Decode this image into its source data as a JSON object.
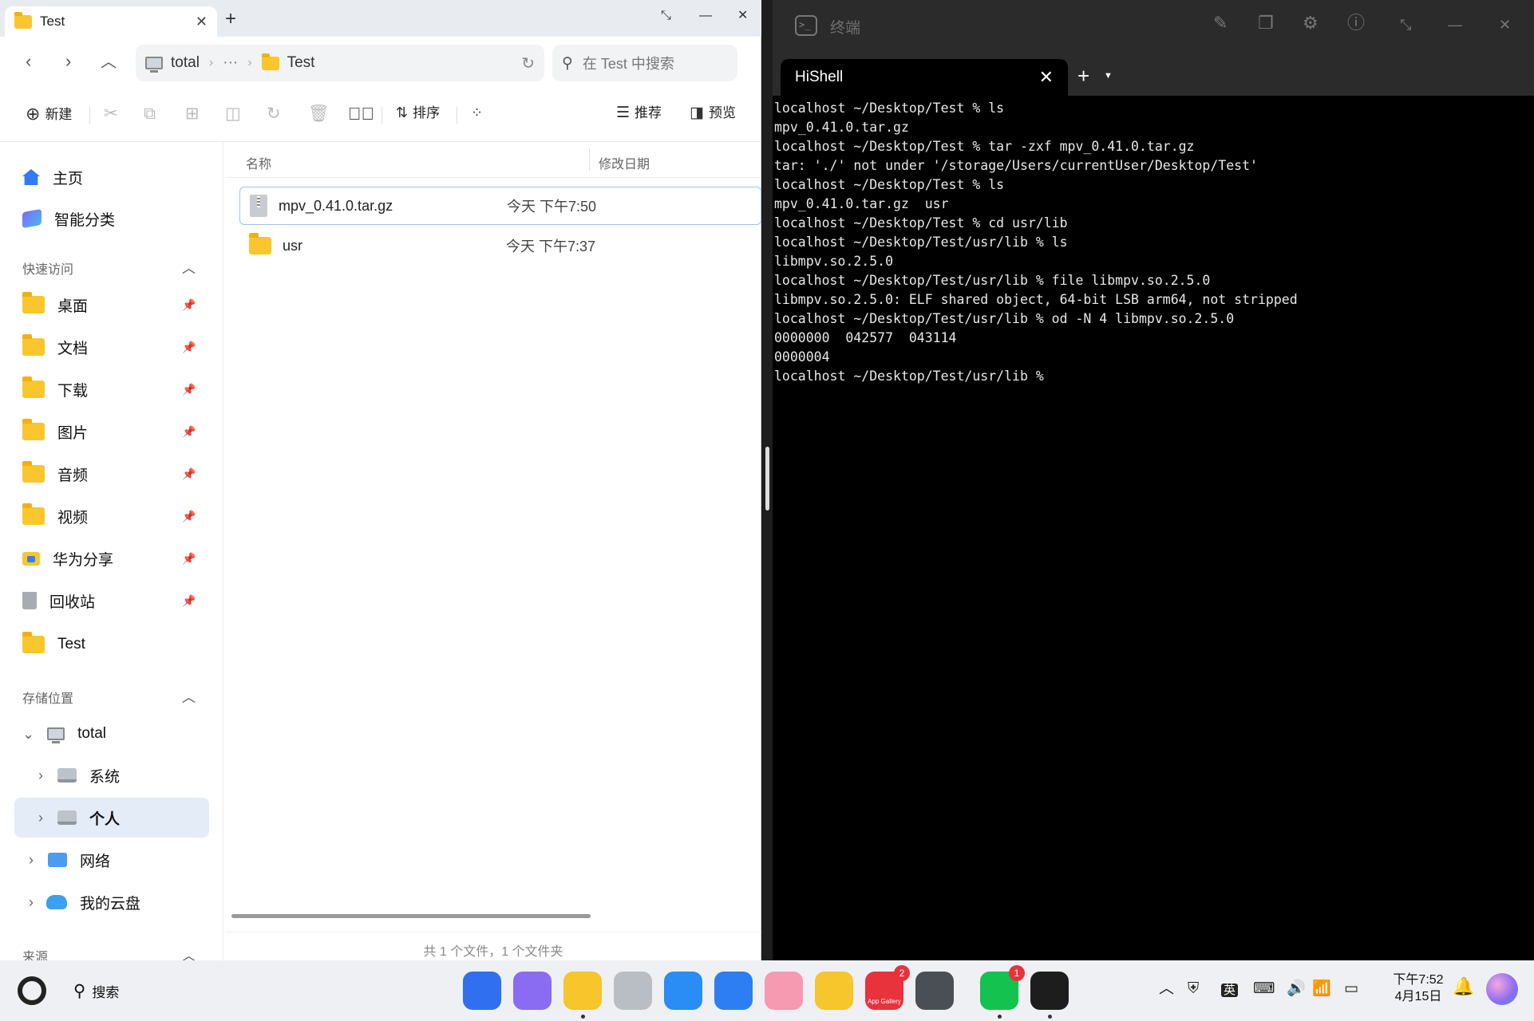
{
  "file_manager": {
    "tab_title": "Test",
    "address": {
      "root": "total",
      "ellipsis": "···",
      "current": "Test"
    },
    "search_placeholder": "在 Test 中搜索",
    "toolbar": {
      "new_label": "新建",
      "sort_label": "排序",
      "recommend_label": "推荐",
      "preview_label": "预览"
    },
    "sidebar": {
      "top_items": [
        {
          "label": "主页",
          "icon": "home-icon"
        },
        {
          "label": "智能分类",
          "icon": "smart-category-icon"
        }
      ],
      "quick_access_title": "快速访问",
      "quick_access": [
        {
          "label": "桌面",
          "icon": "folder-icon"
        },
        {
          "label": "文档",
          "icon": "folder-icon"
        },
        {
          "label": "下载",
          "icon": "folder-icon"
        },
        {
          "label": "图片",
          "icon": "folder-icon"
        },
        {
          "label": "音频",
          "icon": "folder-icon"
        },
        {
          "label": "视频",
          "icon": "folder-icon"
        },
        {
          "label": "华为分享",
          "icon": "share-folder-icon"
        },
        {
          "label": "回收站",
          "icon": "trash-icon"
        },
        {
          "label": "Test",
          "icon": "folder-icon"
        }
      ],
      "storage_title": "存储位置",
      "storage": [
        {
          "label": "total",
          "icon": "computer-icon"
        },
        {
          "label": "系统",
          "icon": "drive-icon"
        },
        {
          "label": "个人",
          "icon": "drive-icon"
        },
        {
          "label": "网络",
          "icon": "network-icon"
        },
        {
          "label": "我的云盘",
          "icon": "cloud-icon"
        }
      ],
      "source_title": "来源"
    },
    "columns": {
      "name": "名称",
      "modified": "修改日期"
    },
    "files": [
      {
        "name": "mpv_0.41.0.tar.gz",
        "modified": "今天 下午7:50",
        "type": "archive"
      },
      {
        "name": "usr",
        "modified": "今天 下午7:37",
        "type": "folder"
      }
    ],
    "status": "共 1 个文件，1 个文件夹"
  },
  "terminal": {
    "window_title": "终端",
    "tab_title": "HiShell",
    "lines": [
      "localhost ~/Desktop/Test % ls",
      "mpv_0.41.0.tar.gz",
      "localhost ~/Desktop/Test % tar -zxf mpv_0.41.0.tar.gz",
      "tar: './' not under '/storage/Users/currentUser/Desktop/Test'",
      "localhost ~/Desktop/Test % ls",
      "mpv_0.41.0.tar.gz  usr",
      "localhost ~/Desktop/Test % cd usr/lib",
      "localhost ~/Desktop/Test/usr/lib % ls",
      "libmpv.so.2.5.0",
      "localhost ~/Desktop/Test/usr/lib % file libmpv.so.2.5.0",
      "libmpv.so.2.5.0: ELF shared object, 64-bit LSB arm64, not stripped",
      "localhost ~/Desktop/Test/usr/lib % od -N 4 libmpv.so.2.5.0",
      "0000000  042577  043114",
      "0000004",
      "localhost ~/Desktop/Test/usr/lib % "
    ]
  },
  "taskbar": {
    "search_label": "搜索",
    "apps": [
      {
        "name": "app-launcher",
        "color": "#2f6ff0"
      },
      {
        "name": "multitask",
        "color": "#8a6cf2"
      },
      {
        "name": "files",
        "color": "#f7c52c"
      },
      {
        "name": "recycle-bin",
        "color": "#b9bec4"
      },
      {
        "name": "browser",
        "color": "#2a8cf5"
      },
      {
        "name": "mail",
        "color": "#2d7ef3"
      },
      {
        "name": "gallery",
        "color": "#f59ab0"
      },
      {
        "name": "notes",
        "color": "#f7c52c"
      },
      {
        "name": "app-gallery",
        "color": "#e8323c",
        "badge": "2",
        "label": "App Gallery"
      },
      {
        "name": "settings",
        "color": "#4a4f55"
      },
      {
        "name": "wechat",
        "color": "#13c24f",
        "badge": "1"
      },
      {
        "name": "terminal",
        "color": "#1d1d1d"
      }
    ],
    "ime_label": "英",
    "time": "下午7:52",
    "date": "4月15日"
  }
}
